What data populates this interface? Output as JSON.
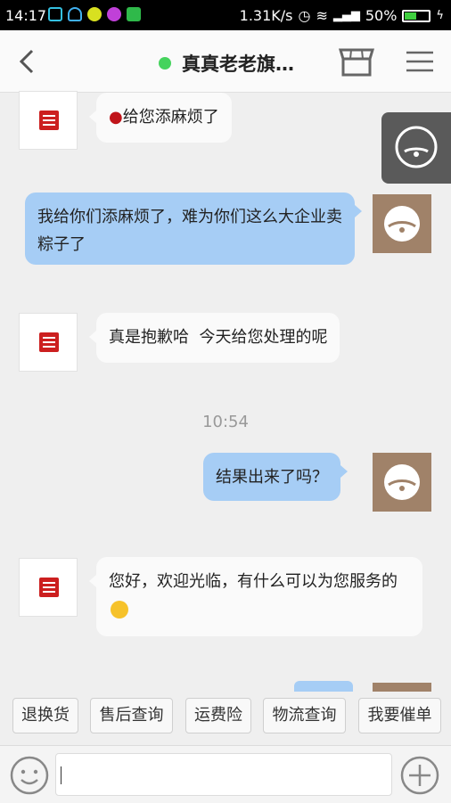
{
  "status_bar": {
    "time": "14:17",
    "speed": "1.31K/s",
    "battery": "50%",
    "battery_level": 0.5
  },
  "header": {
    "title": "真真老老旗…"
  },
  "messages": [
    {
      "side": "left",
      "text": "给您添麻烦了"
    },
    {
      "side": "right",
      "text": "我给你们添麻烦了，难为你们这么大企业卖粽子了"
    },
    {
      "side": "left",
      "text": "真是抱歉哈  今天给您处理的呢"
    },
    {
      "side": "right",
      "text": "结果出来了吗？"
    },
    {
      "side": "left",
      "text": "您好，欢迎光临，有什么可以为您服务的"
    }
  ],
  "timestamp": "10:54",
  "quick_replies": [
    "退换货",
    "售后查询",
    "运费险",
    "物流查询",
    "我要催单"
  ],
  "colors": {
    "user_bubble": "#a6cdf5",
    "shop_bubble": "#fafafa",
    "online": "#45d35d"
  }
}
